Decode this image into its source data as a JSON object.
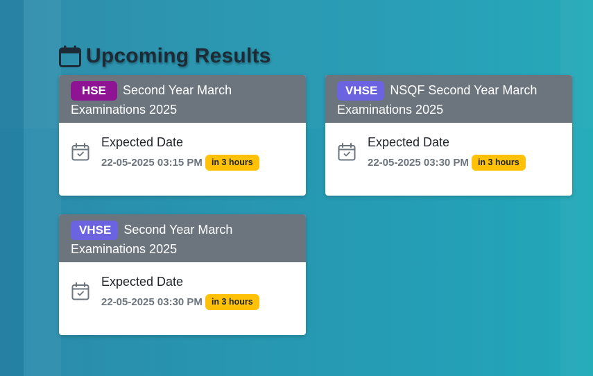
{
  "page": {
    "heading": "Upcoming Results",
    "heading_icon": "calendar-icon"
  },
  "colors": {
    "background": "#2896b0",
    "card_header": "#6c757d",
    "badge_hse": "#8e1494",
    "badge_vhse": "#6b63e0",
    "time_badge": "#ffc107"
  },
  "results": [
    {
      "stream": "HSE",
      "title": "Second Year March Examinations 2025",
      "expected_label": "Expected Date",
      "date": "22-05-2025 03:15 PM",
      "relative": "in 3 hours",
      "icon": "calendar-check-icon"
    },
    {
      "stream": "VHSE",
      "title": "NSQF Second Year March Examinations 2025",
      "expected_label": "Expected Date",
      "date": "22-05-2025 03:30 PM",
      "relative": "in 3 hours",
      "icon": "calendar-check-icon"
    },
    {
      "stream": "VHSE",
      "title": "Second Year March Examinations 2025",
      "expected_label": "Expected Date",
      "date": "22-05-2025 03:30 PM",
      "relative": "in 3 hours",
      "icon": "calendar-check-icon"
    }
  ]
}
